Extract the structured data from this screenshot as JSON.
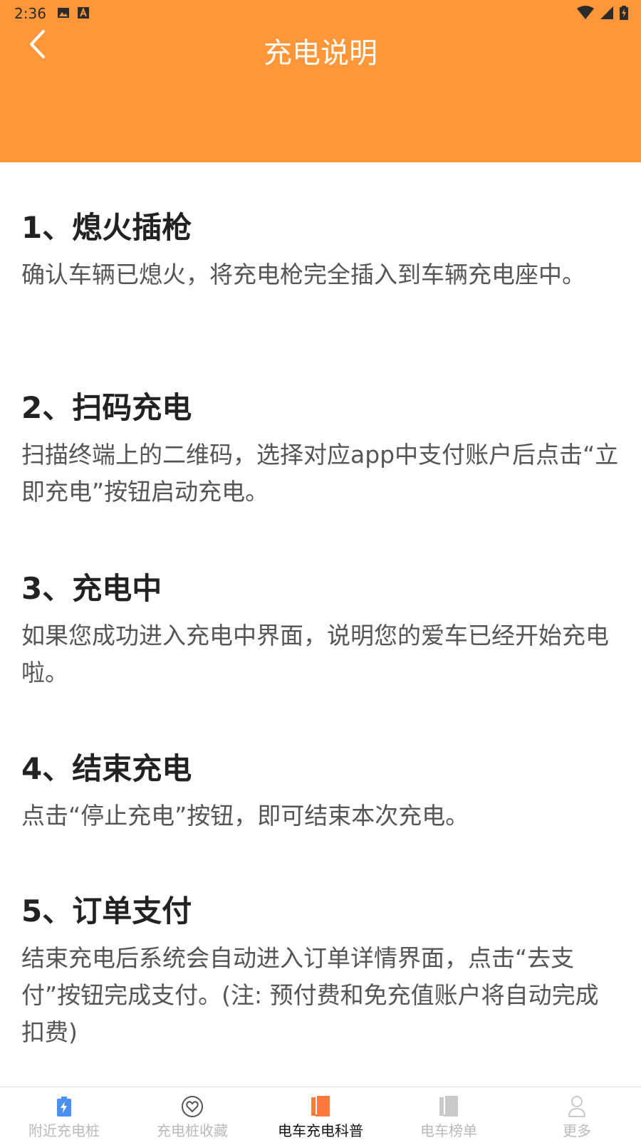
{
  "status_bar": {
    "time": "2:36"
  },
  "header": {
    "title": "充电说明",
    "accent_color": "#FF963A"
  },
  "sections": [
    {
      "title": "1、熄火插枪",
      "body": "确认车辆已熄火，将充电枪完全插入到车辆充电座中。"
    },
    {
      "title": "2、扫码充电",
      "body": "扫描终端上的二维码，选择对应app中支付账户后点击“立即充电”按钮启动充电。"
    },
    {
      "title": "3、充电中",
      "body": "如果您成功进入充电中界面，说明您的爱车已经开始充电啦。"
    },
    {
      "title": "4、结束充电",
      "body": "点击“停止充电”按钮，即可结束本次充电。"
    },
    {
      "title": "5、订单支付",
      "body": "结束充电后系统会自动进入订单详情界面，点击“去支付”按钮完成支付。(注: 预付费和免充值账户将自动完成扣费)"
    }
  ],
  "bottom_nav": {
    "items": [
      {
        "label": "附近充电桩",
        "icon": "charging-battery-icon",
        "active": false
      },
      {
        "label": "充电桩收藏",
        "icon": "heart-icon",
        "active": false
      },
      {
        "label": "电车充电科普",
        "icon": "book-icon",
        "active": true
      },
      {
        "label": "电车榜单",
        "icon": "list-book-icon",
        "active": false
      },
      {
        "label": "更多",
        "icon": "person-icon",
        "active": false
      }
    ],
    "active_color": "#FF7A3D",
    "inactive_color": "#b9b9b9"
  }
}
